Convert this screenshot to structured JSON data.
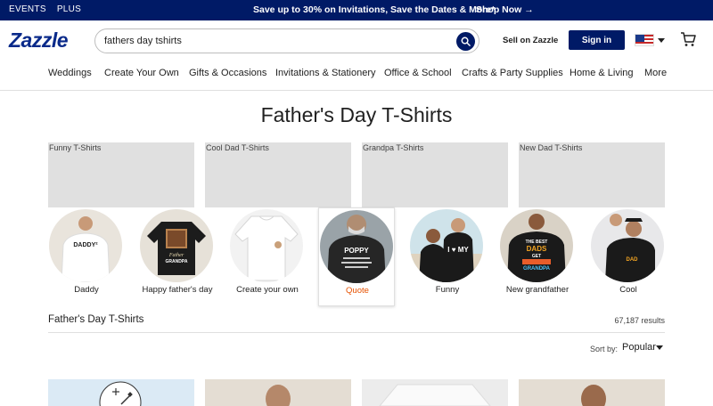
{
  "promo": {
    "left_links": [
      "EVENTS",
      "PLUS"
    ],
    "message": "Save up to 30% on Invitations, Save the Dates & More*",
    "shop_now": "Shop Now →"
  },
  "header": {
    "logo": "Zazzle",
    "search_value": "fathers day tshirts",
    "sell_label": "Sell on Zazzle",
    "signin_label": "Sign in"
  },
  "nav": {
    "items": [
      "Weddings",
      "Create Your Own",
      "Gifts & Occasions",
      "Invitations & Stationery",
      "Office & School",
      "Crafts & Party Supplies",
      "Home & Living",
      "More"
    ]
  },
  "page_title": "Father's Day T-Shirts",
  "tiles": [
    "Funny T-Shirts",
    "Cool Dad T-Shirts",
    "Grandpa T-Shirts",
    "New Dad T-Shirts"
  ],
  "circles": [
    {
      "label": "Daddy",
      "shirt": "DADDY²"
    },
    {
      "label": "Happy father's day",
      "shirt": "GRANDPA"
    },
    {
      "label": "Create your own"
    },
    {
      "label": "Quote",
      "shirt": "POPPY"
    },
    {
      "label": "Funny",
      "shirt": "I ♥ MY"
    },
    {
      "label": "New grandfather",
      "shirt": "THE BEST DADS GET PROMOTED TO GRANDPA"
    },
    {
      "label": "Cool",
      "shirt": "DAD"
    }
  ],
  "results": {
    "title": "Father's Day T-Shirts",
    "count": "67,187 results",
    "sort_label": "Sort by:",
    "sort_value": "Popular"
  },
  "colors": {
    "brand_navy": "#001a66",
    "active_orange": "#e65100"
  }
}
